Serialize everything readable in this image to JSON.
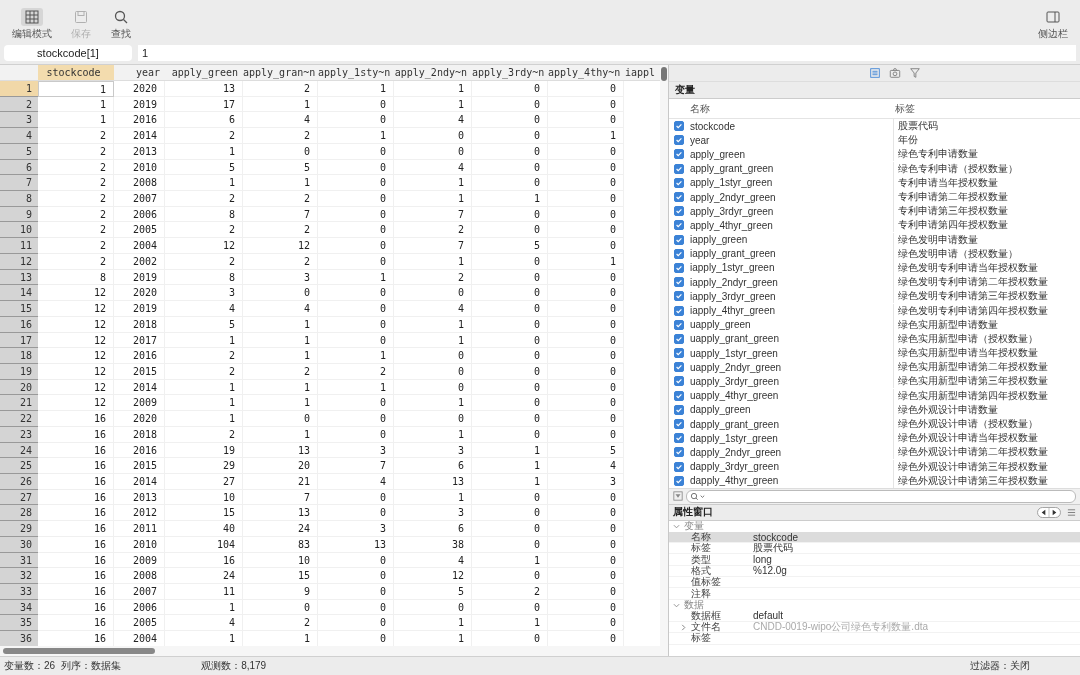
{
  "toolbar": {
    "left": [
      {
        "kind": "edit",
        "label": "编辑模式",
        "selected": true,
        "disabled": false
      },
      {
        "kind": "save",
        "label": "保存",
        "selected": false,
        "disabled": true
      },
      {
        "kind": "find",
        "label": "查找",
        "selected": false,
        "disabled": false
      }
    ],
    "right": [
      {
        "kind": "sidebar",
        "label": "侧边栏",
        "selected": false,
        "disabled": false
      }
    ]
  },
  "command_bar": {
    "cell": "stockcode[1]",
    "value": "1"
  },
  "table": {
    "columns": [
      {
        "label": "stockcode",
        "selected": true
      },
      {
        "label": "year",
        "selected": false
      },
      {
        "label": "apply_green",
        "selected": false
      },
      {
        "label": "apply_gran~n",
        "selected": false
      },
      {
        "label": "apply_1sty~n",
        "selected": false
      },
      {
        "label": "apply_2ndy~n",
        "selected": false
      },
      {
        "label": "apply_3rdy~n",
        "selected": false
      },
      {
        "label": "apply_4thy~n",
        "selected": false
      },
      {
        "label": "iappl",
        "selected": false
      }
    ],
    "rows": [
      {
        "n": "1",
        "selected": true,
        "cells": [
          "1",
          "2020",
          "13",
          "2",
          "1",
          "1",
          "0",
          "0"
        ]
      },
      {
        "n": "2",
        "selected": false,
        "cells": [
          "1",
          "2019",
          "17",
          "1",
          "0",
          "1",
          "0",
          "0"
        ]
      },
      {
        "n": "3",
        "selected": false,
        "cells": [
          "1",
          "2016",
          "6",
          "4",
          "0",
          "4",
          "0",
          "0"
        ]
      },
      {
        "n": "4",
        "selected": false,
        "cells": [
          "2",
          "2014",
          "2",
          "2",
          "1",
          "0",
          "0",
          "1"
        ]
      },
      {
        "n": "5",
        "selected": false,
        "cells": [
          "2",
          "2013",
          "1",
          "0",
          "0",
          "0",
          "0",
          "0"
        ]
      },
      {
        "n": "6",
        "selected": false,
        "cells": [
          "2",
          "2010",
          "5",
          "5",
          "0",
          "4",
          "0",
          "0"
        ]
      },
      {
        "n": "7",
        "selected": false,
        "cells": [
          "2",
          "2008",
          "1",
          "1",
          "0",
          "1",
          "0",
          "0"
        ]
      },
      {
        "n": "8",
        "selected": false,
        "cells": [
          "2",
          "2007",
          "2",
          "2",
          "0",
          "1",
          "1",
          "0"
        ]
      },
      {
        "n": "9",
        "selected": false,
        "cells": [
          "2",
          "2006",
          "8",
          "7",
          "0",
          "7",
          "0",
          "0"
        ]
      },
      {
        "n": "10",
        "selected": false,
        "cells": [
          "2",
          "2005",
          "2",
          "2",
          "0",
          "2",
          "0",
          "0"
        ]
      },
      {
        "n": "11",
        "selected": false,
        "cells": [
          "2",
          "2004",
          "12",
          "12",
          "0",
          "7",
          "5",
          "0"
        ]
      },
      {
        "n": "12",
        "selected": false,
        "cells": [
          "2",
          "2002",
          "2",
          "2",
          "0",
          "1",
          "0",
          "1"
        ]
      },
      {
        "n": "13",
        "selected": false,
        "cells": [
          "8",
          "2019",
          "8",
          "3",
          "1",
          "2",
          "0",
          "0"
        ]
      },
      {
        "n": "14",
        "selected": false,
        "cells": [
          "12",
          "2020",
          "3",
          "0",
          "0",
          "0",
          "0",
          "0"
        ]
      },
      {
        "n": "15",
        "selected": false,
        "cells": [
          "12",
          "2019",
          "4",
          "4",
          "0",
          "4",
          "0",
          "0"
        ]
      },
      {
        "n": "16",
        "selected": false,
        "cells": [
          "12",
          "2018",
          "5",
          "1",
          "0",
          "1",
          "0",
          "0"
        ]
      },
      {
        "n": "17",
        "selected": false,
        "cells": [
          "12",
          "2017",
          "1",
          "1",
          "0",
          "1",
          "0",
          "0"
        ]
      },
      {
        "n": "18",
        "selected": false,
        "cells": [
          "12",
          "2016",
          "2",
          "1",
          "1",
          "0",
          "0",
          "0"
        ]
      },
      {
        "n": "19",
        "selected": false,
        "cells": [
          "12",
          "2015",
          "2",
          "2",
          "2",
          "0",
          "0",
          "0"
        ]
      },
      {
        "n": "20",
        "selected": false,
        "cells": [
          "12",
          "2014",
          "1",
          "1",
          "1",
          "0",
          "0",
          "0"
        ]
      },
      {
        "n": "21",
        "selected": false,
        "cells": [
          "12",
          "2009",
          "1",
          "1",
          "0",
          "1",
          "0",
          "0"
        ]
      },
      {
        "n": "22",
        "selected": false,
        "cells": [
          "16",
          "2020",
          "1",
          "0",
          "0",
          "0",
          "0",
          "0"
        ]
      },
      {
        "n": "23",
        "selected": false,
        "cells": [
          "16",
          "2018",
          "2",
          "1",
          "0",
          "1",
          "0",
          "0"
        ]
      },
      {
        "n": "24",
        "selected": false,
        "cells": [
          "16",
          "2016",
          "19",
          "13",
          "3",
          "3",
          "1",
          "5"
        ]
      },
      {
        "n": "25",
        "selected": false,
        "cells": [
          "16",
          "2015",
          "29",
          "20",
          "7",
          "6",
          "1",
          "4"
        ]
      },
      {
        "n": "26",
        "selected": false,
        "cells": [
          "16",
          "2014",
          "27",
          "21",
          "4",
          "13",
          "1",
          "3"
        ]
      },
      {
        "n": "27",
        "selected": false,
        "cells": [
          "16",
          "2013",
          "10",
          "7",
          "0",
          "1",
          "0",
          "0"
        ]
      },
      {
        "n": "28",
        "selected": false,
        "cells": [
          "16",
          "2012",
          "15",
          "13",
          "0",
          "3",
          "0",
          "0"
        ]
      },
      {
        "n": "29",
        "selected": false,
        "cells": [
          "16",
          "2011",
          "40",
          "24",
          "3",
          "6",
          "0",
          "0"
        ]
      },
      {
        "n": "30",
        "selected": false,
        "cells": [
          "16",
          "2010",
          "104",
          "83",
          "13",
          "38",
          "0",
          "0"
        ]
      },
      {
        "n": "31",
        "selected": false,
        "cells": [
          "16",
          "2009",
          "16",
          "10",
          "0",
          "4",
          "1",
          "0"
        ]
      },
      {
        "n": "32",
        "selected": false,
        "cells": [
          "16",
          "2008",
          "24",
          "15",
          "0",
          "12",
          "0",
          "0"
        ]
      },
      {
        "n": "33",
        "selected": false,
        "cells": [
          "16",
          "2007",
          "11",
          "9",
          "0",
          "5",
          "2",
          "0"
        ]
      },
      {
        "n": "34",
        "selected": false,
        "cells": [
          "16",
          "2006",
          "1",
          "0",
          "0",
          "0",
          "0",
          "0"
        ]
      },
      {
        "n": "35",
        "selected": false,
        "cells": [
          "16",
          "2005",
          "4",
          "2",
          "0",
          "1",
          "1",
          "0"
        ]
      },
      {
        "n": "36",
        "selected": false,
        "cells": [
          "16",
          "2004",
          "1",
          "1",
          "0",
          "1",
          "0",
          "0"
        ]
      }
    ]
  },
  "variables": {
    "title": "变量",
    "columns": [
      "名称",
      "标签"
    ],
    "items": [
      {
        "name": "stockcode",
        "label": "股票代码",
        "checked": true
      },
      {
        "name": "year",
        "label": "年份",
        "checked": true
      },
      {
        "name": "apply_green",
        "label": "绿色专利申请数量",
        "checked": true
      },
      {
        "name": "apply_grant_green",
        "label": "绿色专利申请（授权数量）",
        "checked": true
      },
      {
        "name": "apply_1styr_green",
        "label": "专利申请当年授权数量",
        "checked": true
      },
      {
        "name": "apply_2ndyr_green",
        "label": "专利申请第二年授权数量",
        "checked": true
      },
      {
        "name": "apply_3rdyr_green",
        "label": "专利申请第三年授权数量",
        "checked": true
      },
      {
        "name": "apply_4thyr_green",
        "label": "专利申请第四年授权数量",
        "checked": true
      },
      {
        "name": "iapply_green",
        "label": "绿色发明申请数量",
        "checked": true
      },
      {
        "name": "iapply_grant_green",
        "label": "绿色发明申请（授权数量）",
        "checked": true
      },
      {
        "name": "iapply_1styr_green",
        "label": "绿色发明专利申请当年授权数量",
        "checked": true
      },
      {
        "name": "iapply_2ndyr_green",
        "label": "绿色发明专利申请第二年授权数量",
        "checked": true
      },
      {
        "name": "iapply_3rdyr_green",
        "label": "绿色发明专利申请第三年授权数量",
        "checked": true
      },
      {
        "name": "iapply_4thyr_green",
        "label": "绿色发明专利申请第四年授权数量",
        "checked": true
      },
      {
        "name": "uapply_green",
        "label": "绿色实用新型申请数量",
        "checked": true
      },
      {
        "name": "uapply_grant_green",
        "label": "绿色实用新型申请（授权数量）",
        "checked": true
      },
      {
        "name": "uapply_1styr_green",
        "label": "绿色实用新型申请当年授权数量",
        "checked": true
      },
      {
        "name": "uapply_2ndyr_green",
        "label": "绿色实用新型申请第二年授权数量",
        "checked": true
      },
      {
        "name": "uapply_3rdyr_green",
        "label": "绿色实用新型申请第三年授权数量",
        "checked": true
      },
      {
        "name": "uapply_4thyr_green",
        "label": "绿色实用新型申请第四年授权数量",
        "checked": true
      },
      {
        "name": "dapply_green",
        "label": "绿色外观设计申请数量",
        "checked": true
      },
      {
        "name": "dapply_grant_green",
        "label": "绿色外观设计申请（授权数量）",
        "checked": true
      },
      {
        "name": "dapply_1styr_green",
        "label": "绿色外观设计申请当年授权数量",
        "checked": true
      },
      {
        "name": "dapply_2ndyr_green",
        "label": "绿色外观设计申请第二年授权数量",
        "checked": true
      },
      {
        "name": "dapply_3rdyr_green",
        "label": "绿色外观设计申请第三年授权数量",
        "checked": true
      },
      {
        "name": "dapply_4thyr_green",
        "label": "绿色外观设计申请第三年授权数量",
        "checked": true
      }
    ]
  },
  "properties": {
    "title": "属性窗口",
    "groups": [
      {
        "label": "变量",
        "expanded": true,
        "items": [
          {
            "key": "名称",
            "value": "stockcode",
            "selected": true
          },
          {
            "key": "标签",
            "value": "股票代码",
            "selected": false
          },
          {
            "key": "类型",
            "value": "long",
            "selected": false
          },
          {
            "key": "格式",
            "value": "%12.0g",
            "selected": false
          },
          {
            "key": "值标签",
            "selected": false
          },
          {
            "key": "注释",
            "selected": false
          }
        ]
      },
      {
        "label": "数据",
        "expanded": true,
        "items": [
          {
            "key": "数据框",
            "value": "default",
            "selected": false
          },
          {
            "key": "文件名",
            "value": "CNDD-0019-wipo公司绿色专利数量.dta",
            "selected": false,
            "expanded": false
          },
          {
            "key": "标签",
            "selected": false
          }
        ]
      }
    ]
  },
  "status_bar": {
    "vars": "变量数：26",
    "order": "列序：数据集",
    "obs": "观测数：8,179",
    "filter": "过滤器：关闭"
  }
}
